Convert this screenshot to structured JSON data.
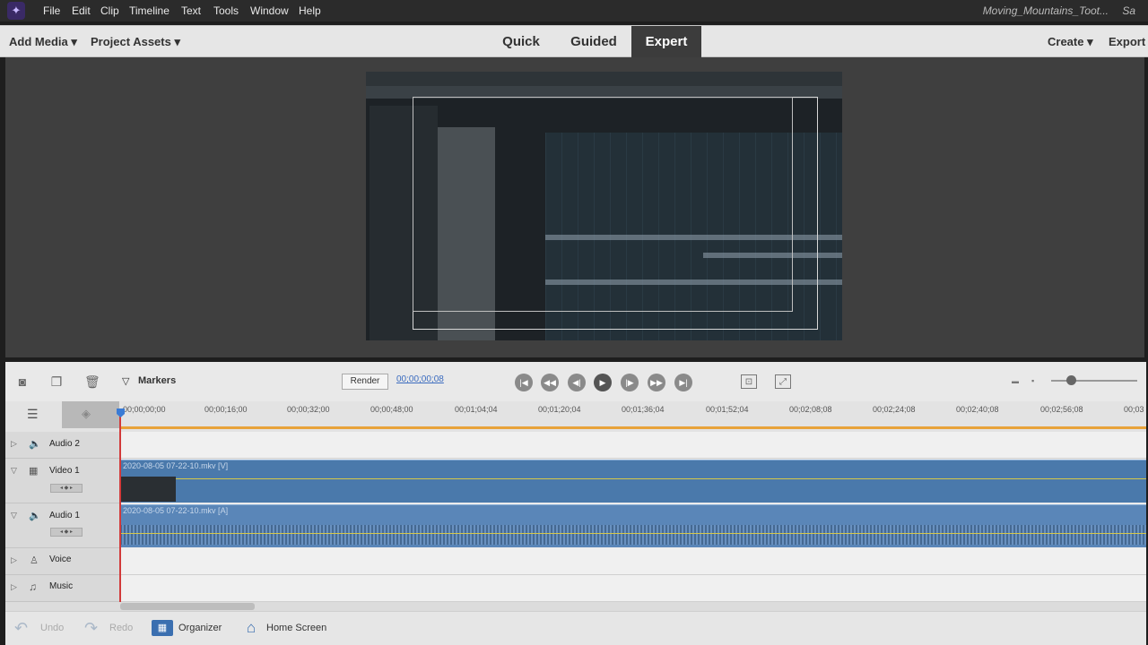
{
  "menubar": {
    "items": [
      "File",
      "Edit",
      "Clip",
      "Timeline",
      "Text",
      "Tools",
      "Window",
      "Help"
    ],
    "title": "Moving_Mountains_Toot...",
    "right_stub": "Sa"
  },
  "modebar": {
    "add_media": "Add Media",
    "project_assets": "Project Assets",
    "modes": [
      "Quick",
      "Guided",
      "Expert"
    ],
    "active_mode": "Expert",
    "create": "Create",
    "export": "Export"
  },
  "toolbar": {
    "markers": "Markers",
    "render": "Render",
    "timecode": "00;00;00;08"
  },
  "ruler": {
    "ticks": [
      "00;00;00;00",
      "00;00;16;00",
      "00;00;32;00",
      "00;00;48;00",
      "00;01;04;04",
      "00;01;20;04",
      "00;01;36;04",
      "00;01;52;04",
      "00;02;08;08",
      "00;02;24;08",
      "00;02;40;08",
      "00;02;56;08",
      "00;03"
    ]
  },
  "tracks": {
    "audio2": "Audio 2",
    "video1": "Video 1",
    "audio1": "Audio 1",
    "voice": "Voice",
    "music": "Music"
  },
  "clips": {
    "video": "2020-08-05 07-22-10.mkv [V]",
    "audio": "2020-08-05 07-22-10.mkv [A]"
  },
  "status": {
    "undo": "Undo",
    "redo": "Redo",
    "organizer": "Organizer",
    "home": "Home Screen"
  },
  "colors": {
    "accent": "#3c3c3c",
    "clip_video": "#4a79ab",
    "clip_audio": "#5a86b8",
    "playhead": "#d23a3a"
  }
}
